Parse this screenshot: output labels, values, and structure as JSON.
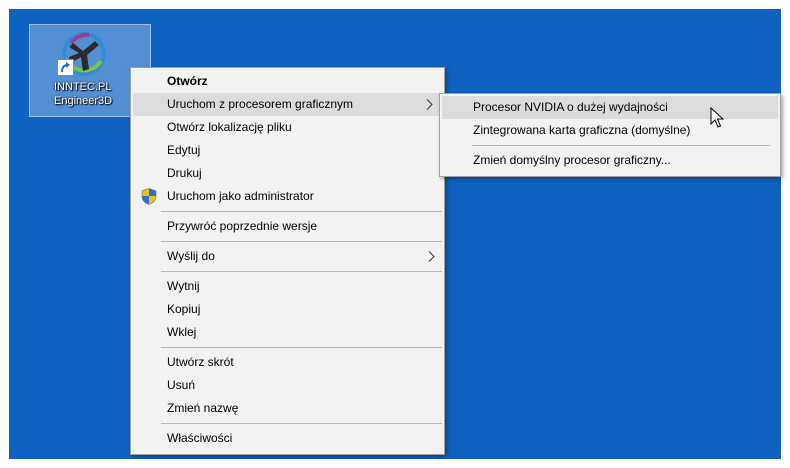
{
  "desktop": {
    "background_color": "#0f62c0",
    "shortcut": {
      "line1": "INNTEC.PL",
      "line2": "Engineer3D",
      "icon": "inntec-engineer3d-app-icon",
      "overlay_icon": "shortcut-arrow-icon"
    }
  },
  "context_menu": {
    "items": [
      {
        "label": "Otwórz"
      },
      {
        "label": "Uruchom z procesorem graficznym"
      },
      {
        "label": "Otwórz lokalizację pliku"
      },
      {
        "label": "Edytuj"
      },
      {
        "label": "Drukuj"
      },
      {
        "label": "Uruchom jako administrator",
        "icon": "uac-shield-icon"
      },
      {
        "label": "Przywróć poprzednie wersje"
      },
      {
        "label": "Wyślij do"
      },
      {
        "label": "Wytnij"
      },
      {
        "label": "Kopiuj"
      },
      {
        "label": "Wklej"
      },
      {
        "label": "Utwórz skrót"
      },
      {
        "label": "Usuń"
      },
      {
        "label": "Zmień nazwę"
      },
      {
        "label": "Właściwości"
      }
    ]
  },
  "gpu_submenu": {
    "items": [
      {
        "label": "Procesor NVIDIA o dużej wydajności"
      },
      {
        "label": "Zintegrowana karta graficzna (domyślne)"
      },
      {
        "label": "Zmień domyślny procesor graficzny..."
      }
    ]
  },
  "colors": {
    "menu_background": "#f2f2f2",
    "highlight": "#dcdcdc",
    "separator": "#b5b5b5"
  }
}
